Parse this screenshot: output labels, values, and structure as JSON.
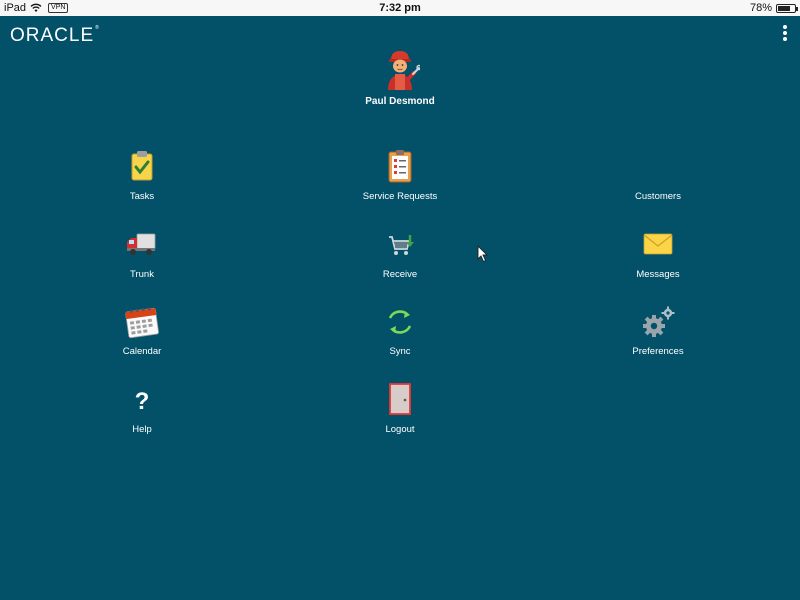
{
  "status_bar": {
    "device": "iPad",
    "vpn": "VPN",
    "time": "7:32 pm",
    "battery": "78%",
    "battery_level": 0.78
  },
  "header": {
    "logo_text": "ORACLE",
    "logo_mark": "®"
  },
  "profile": {
    "name": "Paul Desmond",
    "avatar_icon": "technician-avatar-icon"
  },
  "tiles": [
    {
      "label": "Tasks",
      "icon": "clipboard-check-icon"
    },
    {
      "label": "Service Requests",
      "icon": "checklist-clipboard-icon"
    },
    {
      "label": "Customers",
      "icon": "customers-icon"
    },
    {
      "label": "Trunk",
      "icon": "truck-icon"
    },
    {
      "label": "Receive",
      "icon": "cart-receive-icon"
    },
    {
      "label": "Messages",
      "icon": "envelope-icon"
    },
    {
      "label": "Calendar",
      "icon": "calendar-icon"
    },
    {
      "label": "Sync",
      "icon": "sync-icon"
    },
    {
      "label": "Preferences",
      "icon": "gears-icon"
    },
    {
      "label": "Help",
      "icon": "question-icon"
    },
    {
      "label": "Logout",
      "icon": "door-icon"
    }
  ],
  "colors": {
    "background": "#035069",
    "status_bar": "#f7f7f7",
    "text": "#ffffff"
  }
}
